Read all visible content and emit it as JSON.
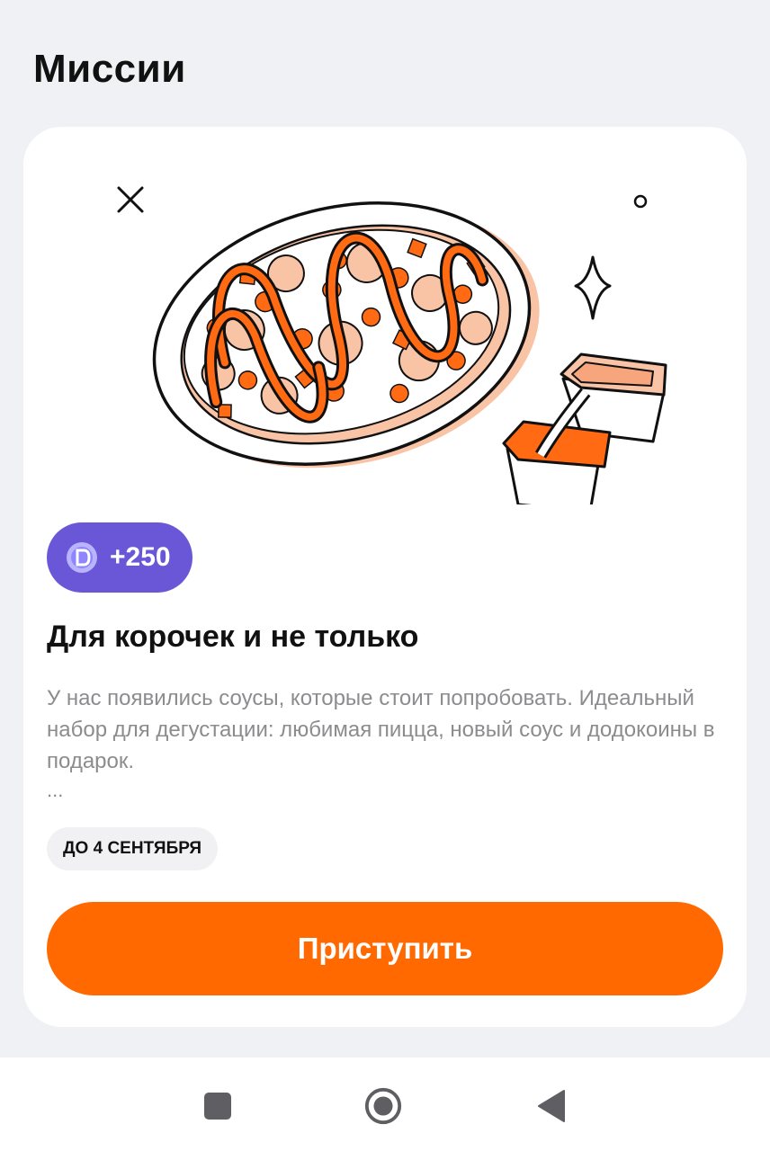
{
  "page": {
    "title": "Миссии"
  },
  "mission": {
    "reward": "+250",
    "title": "Для корочек и не только",
    "description": "У нас появились соусы, которые стоит попробовать. Идеальный набор для дегустации: любимая пицца, новый соус и додокоины в подарок.",
    "ellipsis": "...",
    "deadline": "ДО 4 СЕНТЯБРЯ",
    "button_label": "Приступить"
  },
  "icons": {
    "coin": "dodocoin-icon",
    "nav_recent": "square-icon",
    "nav_home": "circle-icon",
    "nav_back": "triangle-back-icon"
  },
  "colors": {
    "accent": "#ff6900",
    "badge": "#6a57d8",
    "background": "#f0f1f5",
    "card": "#ffffff"
  }
}
